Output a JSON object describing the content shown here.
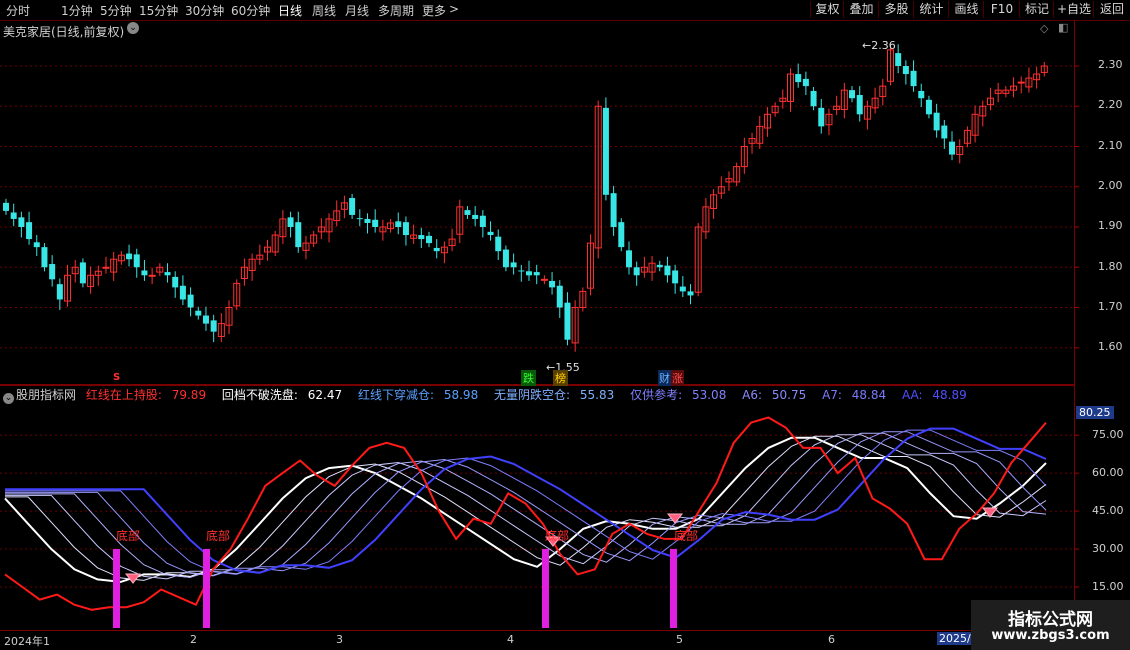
{
  "toolbar": {
    "periods": [
      "分时",
      "1分钟",
      "5分钟",
      "15分钟",
      "30分钟",
      "60分钟",
      "日线",
      "周线",
      "月线",
      "多周期",
      "更多"
    ],
    "active_period": "日线",
    "more_arrow": ">",
    "right_buttons": [
      "复权",
      "叠加",
      "多股",
      "统计",
      "画线",
      "F10",
      "标记",
      "+自选",
      "返回"
    ]
  },
  "chart": {
    "stock_title": "美克家居(日线,前复权)",
    "high_label": "2.36",
    "low_label": "1.55",
    "price_ticks": [
      "2.30",
      "2.20",
      "2.10",
      "2.00",
      "1.90",
      "1.80",
      "1.70",
      "1.60"
    ],
    "markers": [
      {
        "text": "S",
        "color": "#ff3030"
      },
      {
        "text": "跌",
        "color": "#2fff2f"
      },
      {
        "text": "榜",
        "color": "#ffd000"
      },
      {
        "text": "财",
        "color": "#70b0ff"
      },
      {
        "text": "涨",
        "color": "#ff5050"
      }
    ]
  },
  "indicator": {
    "name": "股朋指标网",
    "items": [
      {
        "label": "红线在上持股:",
        "value": "79.89",
        "color": "#ff3030"
      },
      {
        "label": "回档不破洗盘:",
        "value": "62.47",
        "color": "#ffffff"
      },
      {
        "label": "红线下穿减仓:",
        "value": "58.98",
        "color": "#5aa0ff"
      },
      {
        "label": "无量阴跌空仓:",
        "value": "55.83",
        "color": "#7fb0ff"
      },
      {
        "label": "仅供参考:",
        "value": "53.08",
        "color": "#8080ff"
      },
      {
        "label": "A6:",
        "value": "50.75",
        "color": "#8a8aff"
      },
      {
        "label": "A7:",
        "value": "48.84",
        "color": "#7a7aff"
      },
      {
        "label": "AA:",
        "value": "48.89",
        "color": "#5050ff"
      }
    ],
    "y_ticks": [
      "75.00",
      "60.00",
      "45.00",
      "30.00",
      "15.00"
    ],
    "current_value": "80.25",
    "bottom_labels": [
      "底部",
      "底部",
      "底部",
      "底部"
    ]
  },
  "time_axis": {
    "labels": [
      "2024年1",
      "2",
      "3",
      "4",
      "5",
      "6",
      "2025/0"
    ]
  },
  "watermark": {
    "title": "指标公式网",
    "url": "www.zbgs3.com"
  },
  "chart_data": {
    "type": "candlestick",
    "stock": "美克家居",
    "y_range": [
      1.55,
      2.36
    ],
    "red_line": [
      20,
      15,
      10,
      12,
      8,
      6,
      7,
      7,
      9,
      14,
      11,
      8,
      22,
      30,
      42,
      55,
      60,
      65,
      59,
      55,
      63,
      70,
      72,
      70,
      60,
      45,
      34,
      42,
      40,
      52,
      48,
      40,
      28,
      20,
      22,
      36,
      40,
      36,
      34,
      34,
      45,
      56,
      72,
      80,
      82,
      78,
      70,
      70,
      60,
      66,
      50,
      46,
      40,
      26,
      26,
      38,
      44,
      52,
      64,
      72,
      80
    ],
    "white_line": [
      50,
      40,
      30,
      22,
      18,
      17,
      20,
      20,
      19,
      22,
      30,
      40,
      50,
      58,
      62,
      63,
      60,
      55,
      50,
      44,
      38,
      32,
      26,
      23,
      30,
      38,
      41,
      40,
      38,
      38,
      42,
      52,
      62,
      70,
      74,
      74,
      70,
      66,
      66,
      62,
      52,
      43,
      42,
      48,
      55,
      64
    ]
  }
}
